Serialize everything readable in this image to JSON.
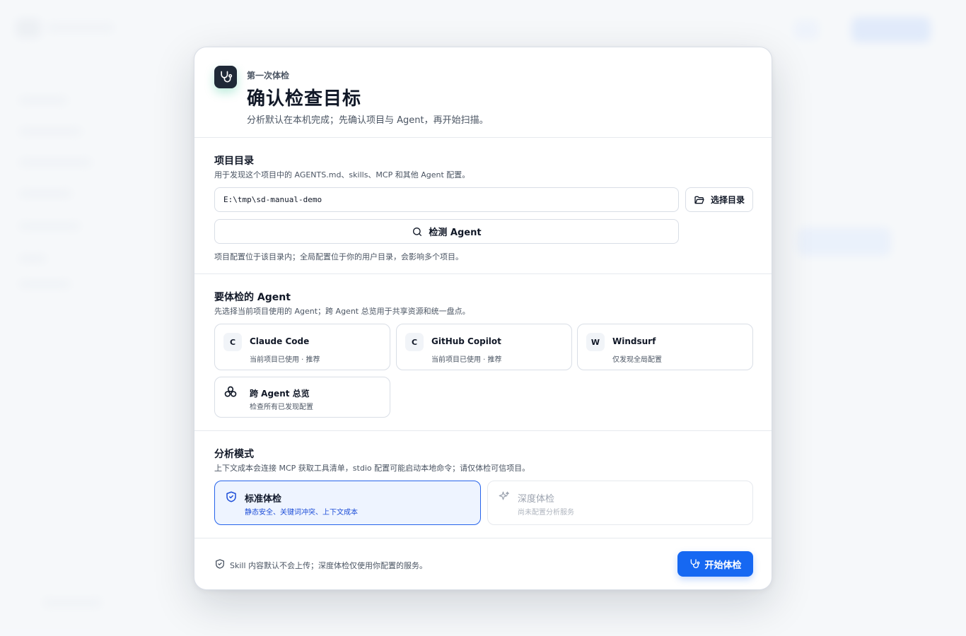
{
  "header": {
    "eyebrow": "第一次体检",
    "title": "确认检查目标",
    "subtitle": "分析默认在本机完成；先确认项目与 Agent，再开始扫描。",
    "icon": "stethoscope-icon"
  },
  "project_dir": {
    "title": "项目目录",
    "desc": "用于发现这个项目中的 AGENTS.md、skills、MCP 和其他 Agent 配置。",
    "path_value": "E:\\tmp\\sd-manual-demo",
    "choose_label": "选择目录",
    "detect_label": "检测 Agent",
    "note": "项目配置位于该目录内；全局配置位于你的用户目录，会影响多个项目。"
  },
  "agents": {
    "title": "要体检的 Agent",
    "desc": "先选择当前项目使用的 Agent；跨 Agent 总览用于共享资源和统一盘点。",
    "items": [
      {
        "letter": "C",
        "name": "Claude Code",
        "sub": "当前项目已使用 · 推荐"
      },
      {
        "letter": "C",
        "name": "GitHub Copilot",
        "sub": "当前项目已使用 · 推荐"
      },
      {
        "letter": "W",
        "name": "Windsurf",
        "sub": "仅发现全局配置"
      }
    ],
    "overview": {
      "name": "跨 Agent 总览",
      "sub": "检查所有已发现配置",
      "icon": "cluster-icon"
    }
  },
  "mode": {
    "title": "分析模式",
    "desc": "上下文成本会连接 MCP 获取工具清单，stdio 配置可能启动本地命令；请仅体检可信项目。",
    "standard": {
      "name": "标准体检",
      "sub": "静态安全、关键词冲突、上下文成本",
      "selected": true
    },
    "deep": {
      "name": "深度体检",
      "sub": "尚未配置分析服务",
      "disabled": true
    }
  },
  "footer": {
    "note": "Skill 内容默认不会上传；深度体检仅使用你配置的服务。",
    "start_label": "开始体检"
  },
  "colors": {
    "accent": "#1668f2",
    "selected_bg": "#eef4ff",
    "dark_icon_bg": "#1f2937"
  }
}
